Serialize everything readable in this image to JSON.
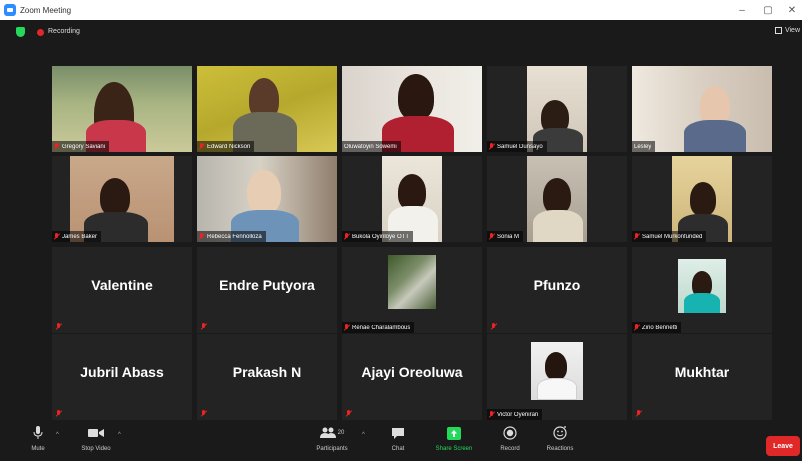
{
  "window": {
    "title": "Zoom Meeting",
    "minimize": "–",
    "maximize": "▢",
    "close": "✕"
  },
  "topbar": {
    "recording": "Recording",
    "view": "View"
  },
  "tiles": [
    {
      "name": "Gregory Saviani"
    },
    {
      "name": "Edward Nickson"
    },
    {
      "name": "Oluwatoyin Sowemi"
    },
    {
      "name": "Samuel Dunsayo"
    },
    {
      "name": "Lesley"
    },
    {
      "name": "James Baker"
    },
    {
      "name": "Rebecca Fennolloza"
    },
    {
      "name": "Bukola Oyinloye OTT"
    },
    {
      "name": "Sonia M"
    },
    {
      "name": "Samuel Murkonfunded"
    },
    {
      "name": "Valentine"
    },
    {
      "name": "Endre Putyora"
    },
    {
      "name": "Renae Charalambous"
    },
    {
      "name": "Pfunzo"
    },
    {
      "name": "Zino Bennetti"
    },
    {
      "name": "Jubril Abass"
    },
    {
      "name": "Prakash N"
    },
    {
      "name": "Ajayi Oreoluwa"
    },
    {
      "name": "Victor Oyeniran"
    },
    {
      "name": "Mukhtar"
    }
  ],
  "toolbar": {
    "mute": "Mute",
    "stop_video": "Stop Video",
    "participants": "Participants",
    "participants_count": "20",
    "chat": "Chat",
    "share_screen": "Share Screen",
    "record": "Record",
    "reactions": "Reactions",
    "leave": "Leave"
  },
  "colors": {
    "accent": "#23d959",
    "recording": "#e02828",
    "active_speaker": "#ffe033",
    "zoom_blue": "#2D8CFF"
  }
}
